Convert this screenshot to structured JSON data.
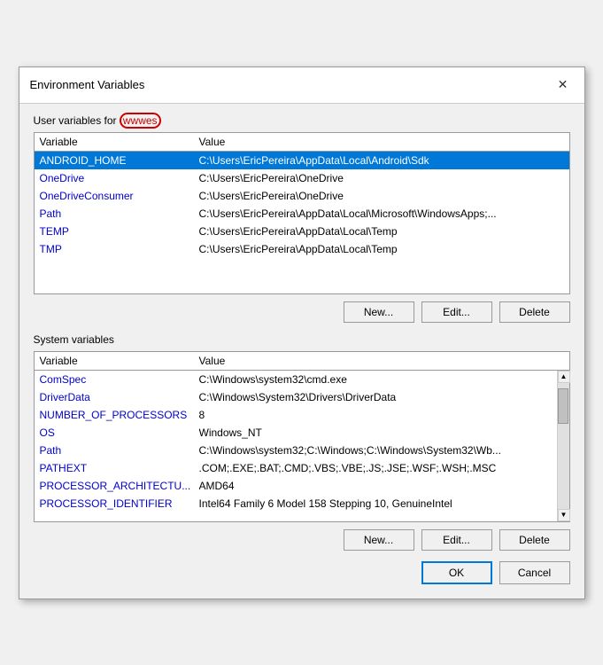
{
  "dialog": {
    "title": "Environment Variables",
    "close_label": "✕"
  },
  "user_section": {
    "label": "User variables for ",
    "username": "wwwes"
  },
  "user_table": {
    "col_var": "Variable",
    "col_val": "Value",
    "rows": [
      {
        "var": "ANDROID_HOME",
        "val": "C:\\Users\\EricPereira\\AppData\\Local\\Android\\Sdk",
        "selected": true
      },
      {
        "var": "OneDrive",
        "val": "C:\\Users\\EricPereira\\OneDrive",
        "selected": false
      },
      {
        "var": "OneDriveConsumer",
        "val": "C:\\Users\\EricPereira\\OneDrive",
        "selected": false
      },
      {
        "var": "Path",
        "val": "C:\\Users\\EricPereira\\AppData\\Local\\Microsoft\\WindowsApps;...",
        "selected": false
      },
      {
        "var": "TEMP",
        "val": "C:\\Users\\EricPereira\\AppData\\Local\\Temp",
        "selected": false
      },
      {
        "var": "TMP",
        "val": "C:\\Users\\EricPereira\\AppData\\Local\\Temp",
        "selected": false
      }
    ]
  },
  "user_buttons": {
    "new": "New...",
    "edit": "Edit...",
    "delete": "Delete"
  },
  "system_section": {
    "label": "System variables"
  },
  "system_table": {
    "col_var": "Variable",
    "col_val": "Value",
    "rows": [
      {
        "var": "ComSpec",
        "val": "C:\\Windows\\system32\\cmd.exe",
        "selected": false
      },
      {
        "var": "DriverData",
        "val": "C:\\Windows\\System32\\Drivers\\DriverData",
        "selected": false
      },
      {
        "var": "NUMBER_OF_PROCESSORS",
        "val": "8",
        "selected": false
      },
      {
        "var": "OS",
        "val": "Windows_NT",
        "selected": false
      },
      {
        "var": "Path",
        "val": "C:\\Windows\\system32;C:\\Windows;C:\\Windows\\System32\\Wb...",
        "selected": false
      },
      {
        "var": "PATHEXT",
        "val": ".COM;.EXE;.BAT;.CMD;.VBS;.VBE;.JS;.JSE;.WSF;.WSH;.MSC",
        "selected": false
      },
      {
        "var": "PROCESSOR_ARCHITECTU...",
        "val": "AMD64",
        "selected": false
      },
      {
        "var": "PROCESSOR_IDENTIFIER",
        "val": "Intel64 Family 6 Model 158 Stepping 10, GenuineIntel",
        "selected": false
      }
    ]
  },
  "system_buttons": {
    "new": "New...",
    "edit": "Edit...",
    "delete": "Delete"
  },
  "bottom_buttons": {
    "ok": "OK",
    "cancel": "Cancel"
  }
}
